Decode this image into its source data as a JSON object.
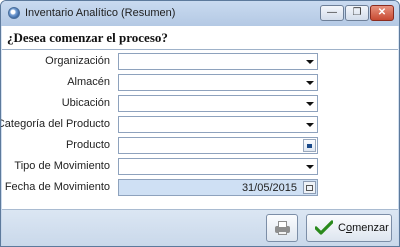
{
  "window": {
    "title": "Inventario Analítico (Resumen)",
    "controls": {
      "minimize": "—",
      "maximize": "❐",
      "close": "✕"
    }
  },
  "header": {
    "question": "¿Desea comenzar el proceso?"
  },
  "form": {
    "fields": [
      {
        "label": "Organización",
        "value": "",
        "kind": "dropdown"
      },
      {
        "label": "Almacén",
        "value": "",
        "kind": "dropdown"
      },
      {
        "label": "Ubicación",
        "value": "",
        "kind": "dropdown"
      },
      {
        "label": "Categoría del Producto",
        "value": "",
        "kind": "dropdown"
      },
      {
        "label": "Producto",
        "value": "",
        "kind": "search"
      },
      {
        "label": "Tipo de Movimiento",
        "value": "",
        "kind": "dropdown"
      },
      {
        "label": "Fecha de Movimiento",
        "value": "31/05/2015",
        "kind": "date"
      }
    ]
  },
  "footer": {
    "start_label_first": "C",
    "start_label_mnemonic": "o",
    "start_label_rest": "menzar"
  },
  "colors": {
    "accent": "#2a8a1c",
    "date_bg": "#cfe0f4",
    "title_bar": "#c9daf0"
  }
}
